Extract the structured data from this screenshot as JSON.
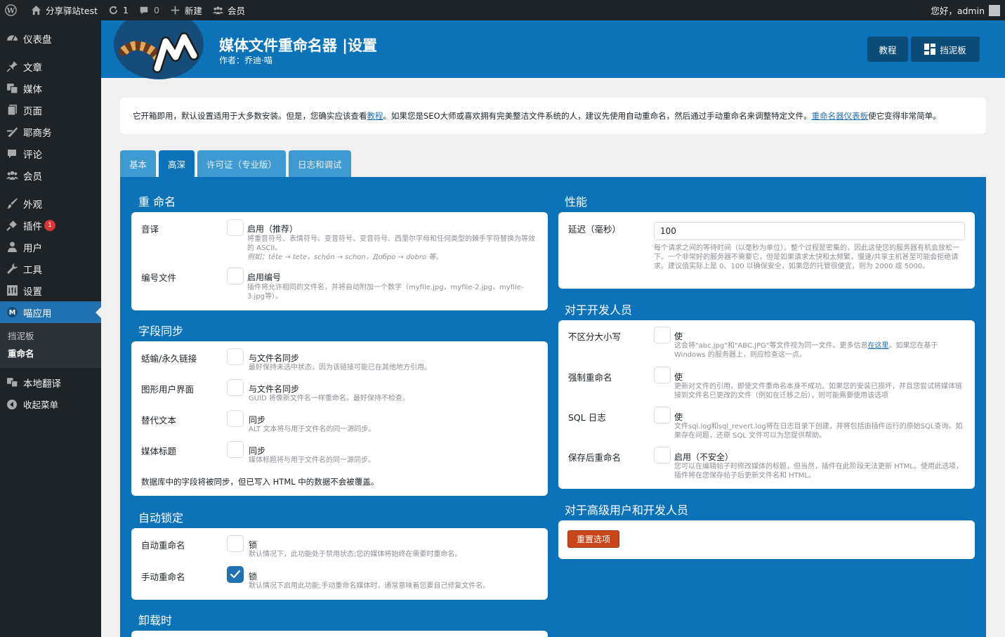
{
  "adminbar": {
    "site_name": "分享驿站test",
    "updates_count": "1",
    "comments_count": "0",
    "new_label": "新建",
    "members_label": "会员",
    "greeting": "您好，admin"
  },
  "sidebar": {
    "items": [
      {
        "label": "仪表盘",
        "icon": "dashboard-icon"
      },
      {
        "label": "文章",
        "icon": "pin-icon"
      },
      {
        "label": "媒体",
        "icon": "media-icon"
      },
      {
        "label": "页面",
        "icon": "page-icon"
      },
      {
        "label": "耶商务",
        "icon": "megaphone-icon"
      },
      {
        "label": "评论",
        "icon": "comment-icon"
      },
      {
        "label": "会员",
        "icon": "groups-icon"
      },
      {
        "label": "外观",
        "icon": "brush-icon"
      },
      {
        "label": "插件",
        "icon": "plugin-icon",
        "badge": "1"
      },
      {
        "label": "用户",
        "icon": "user-icon"
      },
      {
        "label": "工具",
        "icon": "wrench-icon"
      },
      {
        "label": "设置",
        "icon": "settings-icon"
      },
      {
        "label": "喵应用",
        "icon": "meow-icon"
      }
    ],
    "submenu": [
      "挡泥板",
      "重命名"
    ],
    "extra": [
      {
        "label": "本地翻译",
        "icon": "translate-icon"
      },
      {
        "label": "收起菜单",
        "icon": "collapse-icon"
      }
    ]
  },
  "header": {
    "title": "媒体文件重命名器 |设置",
    "subtitle": "作者：乔迪·喵",
    "btn_tutorial": "教程",
    "btn_dashboard": "挡泥板"
  },
  "notice": {
    "part1": "它开箱即用，默认设置适用于大多数安装。但是，您确实应该查看",
    "link1": "教程",
    "part2": "。如果您是SEO大师或喜欢拥有完美整洁文件系统的人，建议先使用自动重命名，然后通过手动重命名来调整特定文件。",
    "link2": "重命名器仪表板",
    "part3": "使它变得非常简单。"
  },
  "tabs": [
    "基本",
    "高深",
    "许可证（专业版）",
    "日志和调试"
  ],
  "rename": {
    "title": "重 命名",
    "rows": [
      {
        "label": "音译",
        "option": "启用（推荐）",
        "desc1": "将重音符号、表情符号、变音符号、变音符号、西里尔字母和任何类型的棘手字符替换为等效的 ASCII。",
        "desc2": "例如：tête → tete，schön → schon，Добро → dobro 等。"
      },
      {
        "label": "编号文件",
        "option": "启用编号",
        "desc1": "插件将允许相同的文件名，并将自动附加一个数字（myfile.jpg，myfile-2.jpg，myfile-3.jpg等）。"
      }
    ]
  },
  "sync": {
    "title": "字段同步",
    "rows": [
      {
        "label": "蛞蝓/永久链接",
        "option": "与文件名同步",
        "desc": "最好保持未选中状态，因为该链接可能已在其他地方引用。"
      },
      {
        "label": "图形用户界面",
        "option": "与文件名同步",
        "desc": "GUID 将像新文件名一样重命名。最好保持不检查。"
      },
      {
        "label": "替代文本",
        "option": "同步",
        "desc": "ALT 文本将与用于文件名的同一源同步。"
      },
      {
        "label": "媒体标题",
        "option": "同步",
        "desc": "媒体标题将与用于文件名的同一源同步。"
      }
    ],
    "note": "数据库中的字段将被同步，但已写入 HTML 中的数据不会被覆盖。"
  },
  "autolock": {
    "title": "自动锁定",
    "rows": [
      {
        "label": "自动重命名",
        "option": "锁",
        "desc": "默认情况下，此功能处于禁用状态;您的媒体将始终在需要时重命名。",
        "checked": false
      },
      {
        "label": "手动重命名",
        "option": "锁",
        "desc": "默认情况下启用此功能;手动重命名媒体时，通常意味着您要自己修复文件名。",
        "checked": true
      }
    ]
  },
  "uninstall": {
    "title": "卸载时"
  },
  "performance": {
    "title": "性能",
    "label": "延迟（毫秒）",
    "value": "100",
    "desc": "每个请求之间的等待时间（以毫秒为单位）。整个过程是密集的，因此这使您的服务器有机会放松一下。一个非常好的服务器不需要它，但是如果请求太快和太频繁，慢速/共享主机甚至可能会拒绝请求。建议值实际上是 0、100 以确保安全，如果您的托管很便宜，则为 2000 或 5000。"
  },
  "developers": {
    "title": "对于开发人员",
    "rows": [
      {
        "label": "不区分大小写",
        "option": "使",
        "desc1": "这会将\"abc.jpg\"和\"ABC.JPG\"等文件视为同一文件。更多信息",
        "link": "在这里",
        "desc2": "。如果您在基于 Windows 的服务器上，则应检查这一点。"
      },
      {
        "label": "强制重命名",
        "option": "使",
        "desc": "更新对文件的引用，即使文件重命名本身不成功。如果您的安装已损坏，并且您尝试将媒体链接到文件名已更改的文件（例如在迁移之后），则可能需要使用该选项"
      },
      {
        "label": "SQL 日志",
        "option": "使",
        "desc": "文件sql.log和sql_revert.log将在日志目录下创建，并将包括由插件运行的原始SQL查询。如果存在问题，还原 SQL 文件可以为您提供帮助。"
      },
      {
        "label": "保存后重命名",
        "option": "启用（不安全）",
        "desc": "您可以在编辑帖子时修改媒体的标题，但当然，插件在此阶段无法更新 HTML。使用此选项，插件将在您保存帖子后更新文件名和 HTML。"
      }
    ]
  },
  "advanced": {
    "title": "对于高级用户和开发人员",
    "reset_label": "重置选项"
  }
}
